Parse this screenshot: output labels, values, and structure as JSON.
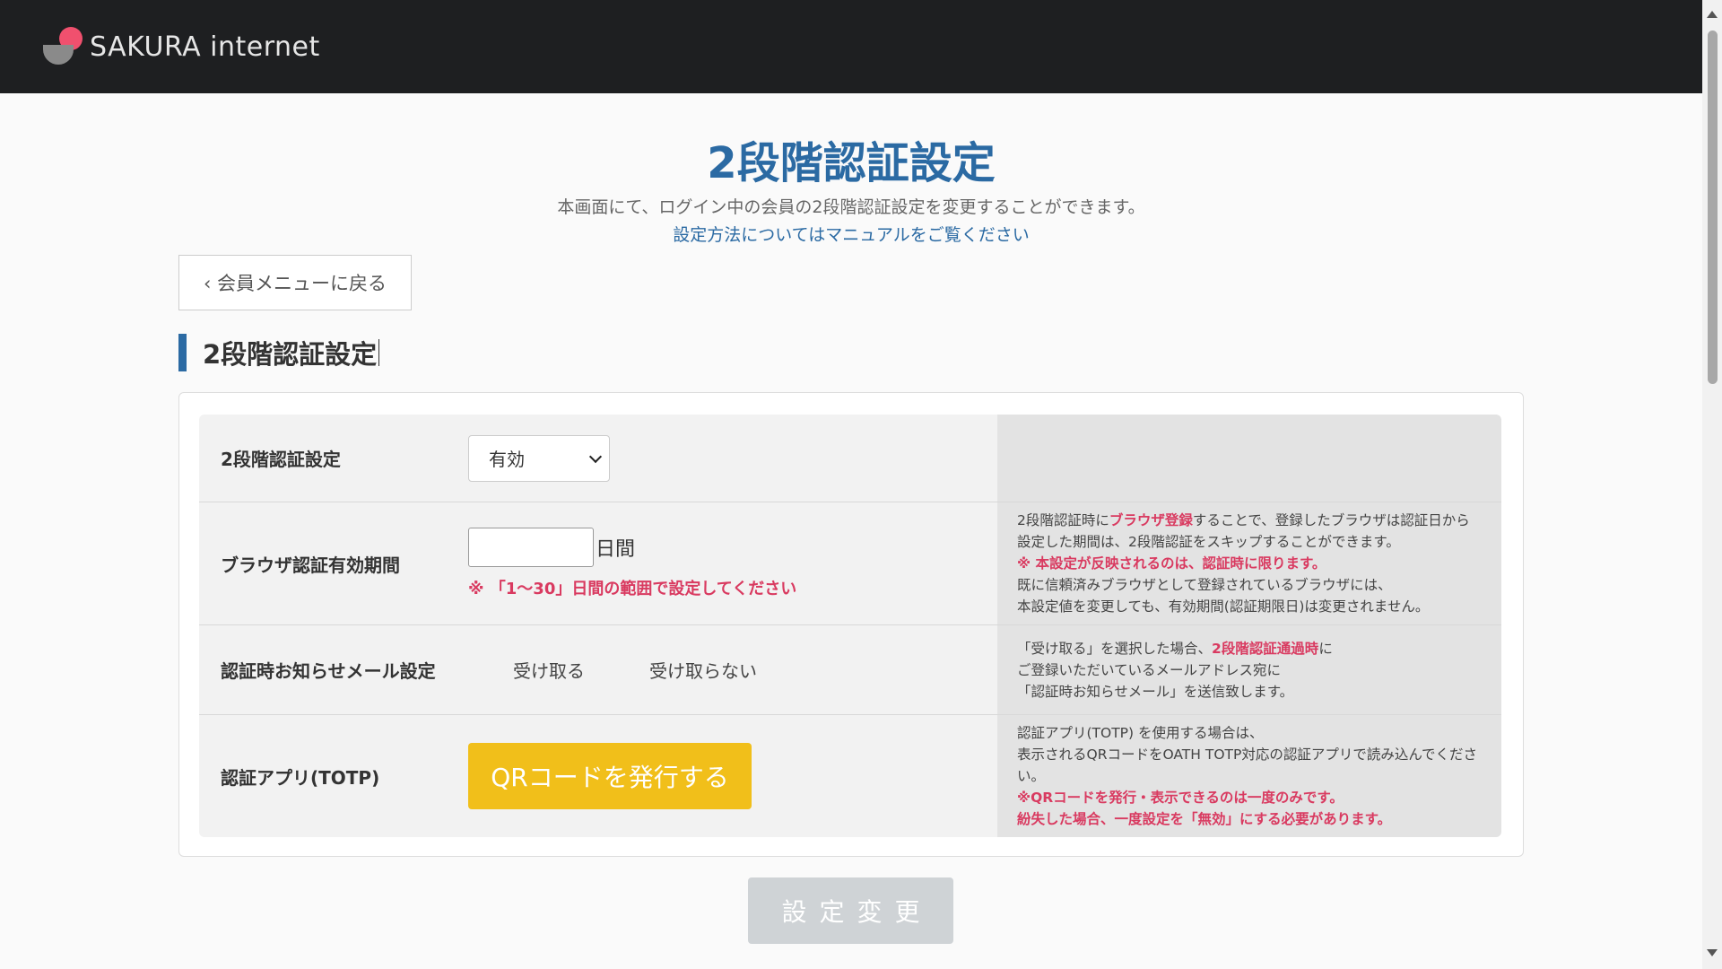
{
  "header": {
    "logo_text": "SAKURA internet"
  },
  "page": {
    "title": "2段階認証設定",
    "description": "本画面にて、ログイン中の会員の2段階認証設定を変更することができます。",
    "manual_link": "設定方法についてはマニュアルをご覧ください",
    "back_button": "‹ 会員メニューに戻る",
    "section_title": "2段階認証設定"
  },
  "form": {
    "two_factor": {
      "label": "2段階認証設定",
      "selected": "有効"
    },
    "browser_period": {
      "label": "ブラウザ認証有効期間",
      "value": "",
      "unit": "日間",
      "hint": "※ 「1〜30」日間の範囲で設定してください",
      "note": {
        "line1_pre": "2段階認証時に",
        "line1_red": "ブラウザ登録",
        "line1_post": "することで、登録したブラウザは認証日から",
        "line2": "設定した期間は、2段階認証をスキップすることができます。",
        "line3_red": "※ 本設定が反映されるのは、認証時に限ります。",
        "line4": "既に信頼済みブラウザとして登録されているブラウザには、",
        "line5": "本設定値を変更しても、有効期間(認証期限日)は変更されません。"
      }
    },
    "mail_setting": {
      "label": "認証時お知らせメール設定",
      "option_receive": "受け取る",
      "option_not_receive": "受け取らない",
      "note": {
        "line1_pre": "「受け取る」を選択した場合、",
        "line1_red": "2段階認証通過時",
        "line1_post": "に",
        "line2": "ご登録いただいているメールアドレス宛に",
        "line3": "「認証時お知らせメール」を送信致します。"
      }
    },
    "totp": {
      "label": "認証アプリ(TOTP)",
      "button": "QRコードを発行する",
      "note": {
        "line1": "認証アプリ(TOTP) を使用する場合は、",
        "line2": "表示されるQRコードをOATH TOTP対応の認証アプリで読み込んでくださ",
        "line3": "い。",
        "line4_red": "※QRコードを発行・表示できるのは一度のみです。",
        "line5_red": "紛失した場合、一度設定を「無効」にする必要があります。"
      }
    },
    "submit": "設定変更"
  },
  "colors": {
    "accent": "#2b6aa3",
    "warning": "#d93a60",
    "qr_button": "#f1bf1a",
    "submit_disabled": "#cfd3d6",
    "topbar": "#1e1f21"
  },
  "icons": {
    "logo": "sakura-logo-icon",
    "select": "chevron-down-icon"
  }
}
